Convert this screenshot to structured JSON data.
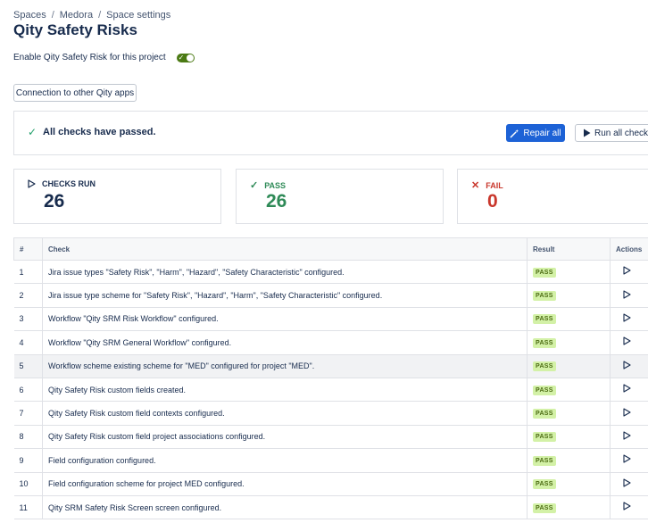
{
  "breadcrumb": [
    "Spaces",
    "Medora",
    "Space settings"
  ],
  "page_title": "Qity Safety Risks",
  "enable_label": "Enable Qity Safety Risk for this project",
  "enable_toggle": {
    "checked": true,
    "icon": "check-icon"
  },
  "connection_button": "Connection to other Qity apps",
  "status": {
    "text": "All checks have passed.",
    "icon": "check-icon"
  },
  "repair_button": {
    "label": "Repair all",
    "icon": "magic-wand-icon"
  },
  "run_all_button": {
    "label": "Run all checks",
    "icon": "play-icon"
  },
  "cards": {
    "run": {
      "label": "CHECKS RUN",
      "value": "26",
      "icon": "play-icon"
    },
    "pass": {
      "label": "PASS",
      "value": "26",
      "icon": "check-icon",
      "color": "#2e8a57"
    },
    "fail": {
      "label": "FAIL",
      "value": "0",
      "icon": "close-icon",
      "color": "#c9372c"
    }
  },
  "table": {
    "headers": {
      "num": "#",
      "check": "Check",
      "result": "Result",
      "actions": "Actions"
    },
    "rows": [
      {
        "num": "1",
        "check": "Jira issue types \"Safety Risk\", \"Harm\", \"Hazard\", \"Safety Characteristic\" configured.",
        "result": "PASS"
      },
      {
        "num": "2",
        "check": "Jira issue type scheme for \"Safety Risk\", \"Hazard\", \"Harm\", \"Safety Characteristic\" configured.",
        "result": "PASS"
      },
      {
        "num": "3",
        "check": "Workflow \"Qity SRM Risk Workflow\" configured.",
        "result": "PASS"
      },
      {
        "num": "4",
        "check": "Workflow \"Qity SRM General Workflow\" configured.",
        "result": "PASS"
      },
      {
        "num": "5",
        "check": "Workflow scheme existing scheme for \"MED\" configured for project \"MED\".",
        "result": "PASS"
      },
      {
        "num": "6",
        "check": "Qity Safety Risk custom fields created.",
        "result": "PASS"
      },
      {
        "num": "7",
        "check": "Qity Safety Risk custom field contexts configured.",
        "result": "PASS"
      },
      {
        "num": "8",
        "check": "Qity Safety Risk custom field project associations configured.",
        "result": "PASS"
      },
      {
        "num": "9",
        "check": "Field configuration configured.",
        "result": "PASS"
      },
      {
        "num": "10",
        "check": "Field configuration scheme for project MED configured.",
        "result": "PASS"
      },
      {
        "num": "11",
        "check": "Qity SRM Safety Risk Screen screen configured.",
        "result": "PASS"
      }
    ]
  }
}
